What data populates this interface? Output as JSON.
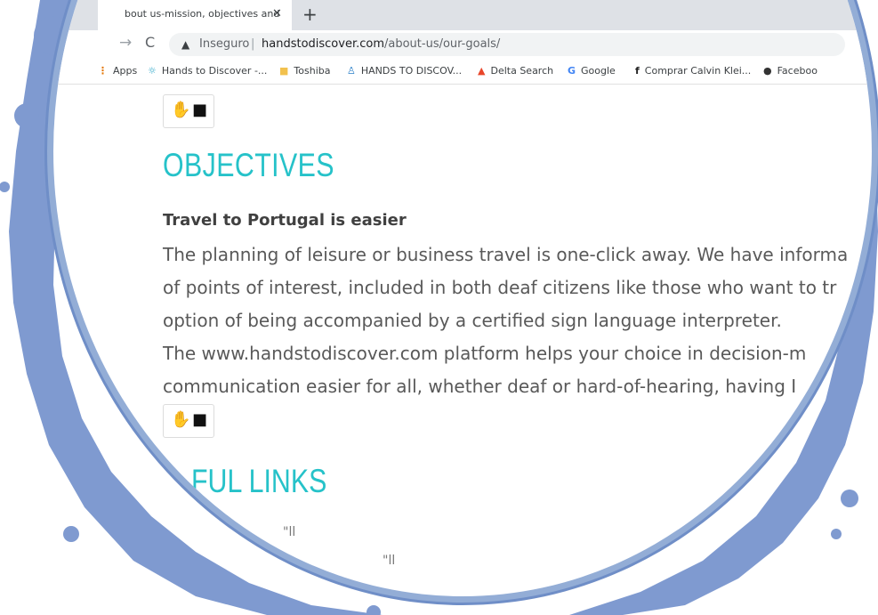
{
  "browser": {
    "tab_title": "bout us-mission, objectives and",
    "tab_close": "✕",
    "new_tab": "+",
    "nav_forward": "→",
    "nav_reload": "C",
    "security_label": "Inseguro",
    "url_host": "handstodiscover.com",
    "url_path": "/about-us/our-goals/"
  },
  "bookmarks": [
    {
      "label": "Apps",
      "icon": "apps-grid-icon"
    },
    {
      "label": "Hands to Discover -...",
      "icon": "sun-icon"
    },
    {
      "label": "Toshiba",
      "icon": "folder-icon"
    },
    {
      "label": "HANDS TO DISCOV...",
      "icon": "site-icon"
    },
    {
      "label": "Delta Search",
      "icon": "delta-icon"
    },
    {
      "label": "Google",
      "icon": "google-icon"
    },
    {
      "label": "Comprar Calvin Klei...",
      "icon": "facebook-icon"
    },
    {
      "label": "Faceboo",
      "icon": "globe-icon"
    }
  ],
  "page": {
    "objectives_heading": "OBJECTIVES",
    "subheading": "Travel to Portugal is easier",
    "para_lines": [
      "The planning of leisure or business travel is one-click away. We have informa",
      "of points of interest, included in both deaf citizens like those who want to tr",
      "option of being accompanied by a certified sign language interpreter.",
      "The www.handstodiscover.com platform helps your choice in decision-m",
      "communication easier for all, whether deaf or hard-of-hearing, having I"
    ],
    "links_heading": "FUL LINKS",
    "faint_1": "\"ll",
    "faint_2": "\"ll"
  },
  "colors": {
    "accent": "#26c2c9",
    "splash": "#7f9ad0",
    "text": "#595959"
  }
}
